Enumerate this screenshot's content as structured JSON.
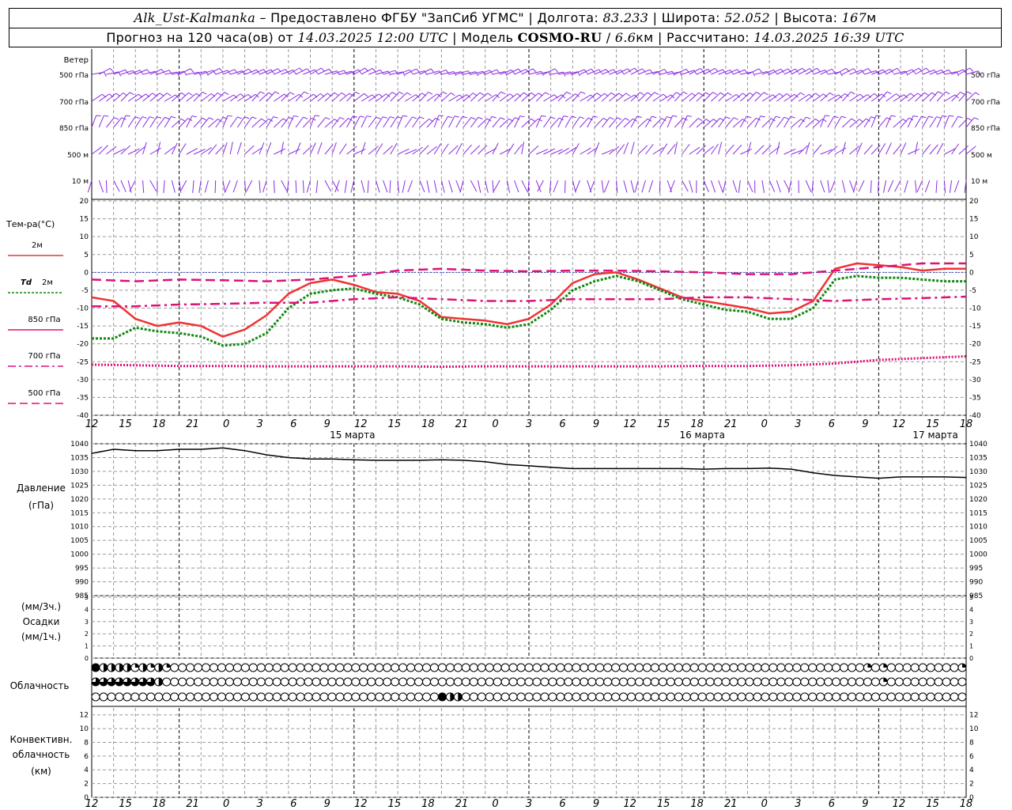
{
  "header": {
    "station": "Alk_Ust-Kalmanka",
    "provider": "Предоставлено ФГБУ \"ЗапСиб УГМС\"",
    "lon_label": "Долгота:",
    "lon_value": "83.233",
    "lat_label": "Широта:",
    "lat_value": "52.052",
    "alt_label": "Высота:",
    "alt_value": "167",
    "alt_unit": "м",
    "forecast_prefix": "Прогноз на 120 часа(ов) от",
    "forecast_start": "14.03.2025 12:00 UTC",
    "model_label": "Модель",
    "model_name": "COSMO-RU",
    "model_res": "6.6",
    "model_res_unit": "км",
    "calc_label": "Рассчитано:",
    "calc_time": "14.03.2025 16:39 UTC"
  },
  "colors": {
    "t2m": "#ee3333",
    "td2m": "#118811",
    "t850": "#dd1177",
    "t700": "#dd1177",
    "t500": "#dd1177",
    "wind": "#8a2be2",
    "pressure": "#000000",
    "grid": "#9a9a9a"
  },
  "wind_panel": {
    "title": "Ветер",
    "levels": [
      "500 гПа",
      "700 гПа",
      "850 гПа",
      "500 м",
      "10 м"
    ]
  },
  "temp_panel": {
    "title": "Тем-ра(°С)",
    "legend": [
      {
        "key": "t2m",
        "label": "2м",
        "label_prefix": "",
        "style": "solid"
      },
      {
        "key": "td2m",
        "label": "2м",
        "label_prefix": "Td",
        "style": "dotted"
      },
      {
        "key": "t850",
        "label": "850 гПа",
        "label_prefix": "",
        "style": "solid"
      },
      {
        "key": "t700",
        "label": "700 гПа",
        "label_prefix": "",
        "style": "dashdot"
      },
      {
        "key": "t500",
        "label": "500 гПа",
        "label_prefix": "",
        "style": "dashed"
      }
    ]
  },
  "pressure_panel": {
    "title_line1": "Давление",
    "title_line2": "(гПа)"
  },
  "precip_panel": {
    "title_line1": "(мм/3ч.)",
    "title_line2": "Осадки",
    "title_line3": "(мм/1ч.)"
  },
  "cloud_panel": {
    "title": "Облачность"
  },
  "conv_panel": {
    "title_line1": "Конвективн.",
    "title_line2": "облачность",
    "title_line3": "(км)"
  },
  "x_tick_labels": [
    "12",
    "15",
    "18",
    "21",
    "0",
    "3",
    "6",
    "9",
    "12",
    "15",
    "18",
    "21",
    "0",
    "3",
    "6",
    "9",
    "12",
    "15",
    "18",
    "21",
    "0",
    "3",
    "6",
    "9",
    "12",
    "15",
    "18"
  ],
  "date_labels": [
    "15 марта",
    "16 марта",
    "17 марта"
  ],
  "chart_data": [
    {
      "type": "line",
      "panel": "temperature",
      "x_unit": "hours since 14.03.2025 12:00 UTC",
      "ylim": [
        -40,
        20
      ],
      "yticks": [
        20,
        15,
        10,
        5,
        0,
        -5,
        -10,
        -15,
        -20,
        -25,
        -30,
        -35,
        -40
      ],
      "series": [
        {
          "name": "2м",
          "key": "t2m",
          "x": [
            0,
            3,
            6,
            9,
            12,
            15,
            18,
            21,
            24,
            27,
            30,
            33,
            36,
            39,
            42,
            45,
            48,
            51,
            54,
            57,
            60,
            63,
            66,
            69,
            72,
            75,
            78,
            81,
            84,
            87,
            90,
            93,
            96,
            99,
            102,
            105,
            108,
            111,
            114,
            117,
            120
          ],
          "y": [
            -7,
            -8,
            -13,
            -15,
            -14,
            -15,
            -18,
            -16,
            -12,
            -6,
            -3,
            -2,
            -3.5,
            -5.5,
            -6,
            -8,
            -12.5,
            -13,
            -13.5,
            -14.5,
            -13,
            -9,
            -3,
            -0.5,
            0,
            -2,
            -4.5,
            -7,
            -8,
            -9,
            -10,
            -11.5,
            -11,
            -8,
            1,
            2.5,
            2,
            1.5,
            0.5,
            1,
            1
          ]
        },
        {
          "name": "Td 2м",
          "key": "td2m",
          "x": [
            0,
            3,
            6,
            9,
            12,
            15,
            18,
            21,
            24,
            27,
            30,
            33,
            36,
            39,
            42,
            45,
            48,
            51,
            54,
            57,
            60,
            63,
            66,
            69,
            72,
            75,
            78,
            81,
            84,
            87,
            90,
            93,
            96,
            99,
            102,
            105,
            108,
            111,
            114,
            117,
            120
          ],
          "y": [
            -18.5,
            -18.5,
            -15.5,
            -16.5,
            -17,
            -18,
            -20.5,
            -20,
            -17,
            -10,
            -6,
            -5,
            -4.5,
            -6,
            -7,
            -9,
            -13,
            -14,
            -14.5,
            -15.5,
            -14.5,
            -10.5,
            -5,
            -2.5,
            -1,
            -2.5,
            -5,
            -7.5,
            -9,
            -10.5,
            -11,
            -13,
            -13,
            -10,
            -2,
            -1,
            -1.5,
            -1.5,
            -2,
            -2.5,
            -2.5
          ]
        },
        {
          "name": "850 гПа",
          "key": "t850",
          "x": [
            0,
            6,
            12,
            18,
            24,
            30,
            36,
            42,
            48,
            54,
            60,
            66,
            72,
            78,
            84,
            90,
            96,
            102,
            108,
            114,
            120
          ],
          "y": [
            -2,
            -2.5,
            -2,
            -2.2,
            -2.5,
            -2,
            -1,
            0.5,
            1,
            0.5,
            0.3,
            0.5,
            0.5,
            0.3,
            0,
            -0.5,
            -0.5,
            0.5,
            1.5,
            2.5,
            2.5
          ]
        },
        {
          "name": "700 гПа",
          "key": "t700",
          "x": [
            0,
            6,
            12,
            18,
            24,
            30,
            36,
            42,
            48,
            54,
            60,
            66,
            72,
            78,
            84,
            90,
            96,
            102,
            108,
            114,
            120
          ],
          "y": [
            -9.5,
            -9.5,
            -9,
            -8.8,
            -8.5,
            -8.5,
            -7.5,
            -7,
            -7.5,
            -8,
            -8,
            -7.5,
            -7.5,
            -7.5,
            -7,
            -7,
            -7.5,
            -8,
            -7.5,
            -7.2,
            -6.8
          ]
        },
        {
          "name": "500 гПа",
          "key": "t500",
          "x": [
            0,
            6,
            12,
            18,
            24,
            30,
            36,
            42,
            48,
            54,
            60,
            66,
            72,
            78,
            84,
            90,
            96,
            102,
            108,
            114,
            120
          ],
          "y": [
            -25.8,
            -26,
            -26.2,
            -26.2,
            -26.3,
            -26.3,
            -26.3,
            -26.3,
            -26.4,
            -26.3,
            -26.3,
            -26.3,
            -26.3,
            -26.3,
            -26.2,
            -26.2,
            -26,
            -25.5,
            -24.5,
            -24,
            -23.5
          ]
        }
      ]
    },
    {
      "type": "line",
      "panel": "pressure",
      "x_unit": "hours since 14.03.2025 12:00 UTC",
      "ylim": [
        985,
        1040
      ],
      "yticks": [
        1040,
        1035,
        1030,
        1025,
        1020,
        1015,
        1010,
        1005,
        1000,
        995,
        990,
        985
      ],
      "series": [
        {
          "name": "Давление",
          "key": "pressure",
          "x": [
            0,
            3,
            6,
            9,
            12,
            15,
            18,
            21,
            24,
            27,
            30,
            33,
            36,
            39,
            42,
            45,
            48,
            51,
            54,
            57,
            60,
            63,
            66,
            69,
            72,
            75,
            78,
            81,
            84,
            87,
            90,
            93,
            96,
            99,
            102,
            105,
            108,
            111,
            114,
            117,
            120
          ],
          "y": [
            1036.5,
            1038,
            1037.5,
            1037.5,
            1038,
            1038,
            1038.5,
            1037.5,
            1036,
            1035,
            1034.5,
            1034.5,
            1034.2,
            1034,
            1034,
            1034,
            1034.2,
            1034,
            1033.5,
            1032.5,
            1032,
            1031.5,
            1031,
            1031,
            1031,
            1031,
            1031,
            1031,
            1030.8,
            1031,
            1031,
            1031.2,
            1030.8,
            1029.5,
            1028.5,
            1028,
            1027.5,
            1028,
            1028,
            1028,
            1027.8
          ]
        }
      ]
    },
    {
      "type": "bar",
      "panel": "precipitation",
      "ylim": [
        0,
        5
      ],
      "yticks": [
        5,
        4,
        3,
        2,
        1,
        0
      ],
      "values": []
    },
    {
      "type": "scatter",
      "panel": "convective_cloud",
      "ylim": [
        0,
        13
      ],
      "yticks": [
        12,
        10,
        8,
        6,
        4,
        2,
        0
      ],
      "values": []
    }
  ],
  "clouds": {
    "row1": [
      4,
      2,
      2,
      2,
      2,
      1,
      2,
      1,
      2,
      1,
      0,
      0,
      0,
      0,
      0,
      0,
      0,
      0,
      0,
      0,
      0,
      0,
      0,
      0,
      0,
      0,
      0,
      0,
      0,
      0,
      0,
      0,
      0,
      0,
      0,
      0,
      0,
      0,
      0,
      0,
      0,
      0,
      0,
      0,
      0,
      0,
      0,
      0,
      0,
      0,
      0,
      0,
      0,
      0,
      0,
      0,
      0,
      0,
      0,
      0,
      0,
      0,
      0,
      0,
      0,
      0,
      0,
      0,
      0,
      0,
      0,
      0,
      0,
      0,
      0,
      0,
      0,
      0,
      0,
      0,
      0,
      0,
      0,
      0,
      0,
      0,
      0,
      0,
      0,
      0,
      0,
      0,
      0,
      0,
      0,
      0,
      0,
      0,
      1,
      0,
      1,
      0,
      0,
      0,
      0,
      0,
      0,
      0,
      0,
      0,
      1
    ],
    "row2": [
      3,
      3,
      3,
      3,
      3,
      3,
      3,
      3,
      2,
      0,
      0,
      0,
      0,
      0,
      0,
      0,
      0,
      0,
      0,
      0,
      0,
      0,
      0,
      0,
      0,
      0,
      0,
      0,
      0,
      0,
      0,
      0,
      0,
      0,
      0,
      0,
      0,
      0,
      0,
      0,
      0,
      0,
      0,
      0,
      0,
      0,
      0,
      0,
      0,
      0,
      0,
      0,
      0,
      0,
      0,
      0,
      0,
      0,
      0,
      0,
      0,
      0,
      0,
      0,
      0,
      0,
      0,
      0,
      0,
      0,
      0,
      0,
      0,
      0,
      0,
      0,
      0,
      0,
      0,
      0,
      0,
      0,
      0,
      0,
      0,
      0,
      0,
      0,
      0,
      0,
      0,
      0,
      0,
      0,
      0,
      0,
      0,
      0,
      0,
      0,
      1,
      0,
      0,
      0,
      0,
      0,
      0,
      0,
      0,
      0,
      0
    ],
    "row3": [
      0,
      0,
      0,
      0,
      0,
      0,
      0,
      0,
      0,
      0,
      0,
      0,
      0,
      0,
      0,
      0,
      0,
      0,
      0,
      0,
      0,
      0,
      0,
      0,
      0,
      0,
      0,
      0,
      0,
      0,
      0,
      0,
      0,
      0,
      0,
      0,
      0,
      0,
      0,
      0,
      0,
      0,
      0,
      0,
      4,
      2,
      2,
      0,
      0,
      0,
      0,
      0,
      0,
      0,
      0,
      0,
      0,
      0,
      0,
      0,
      0,
      0,
      0,
      0,
      0,
      0,
      0,
      0,
      0,
      0,
      0,
      0,
      0,
      0,
      0,
      0,
      0,
      0,
      0,
      0,
      0,
      0,
      0,
      0,
      0,
      0,
      0,
      0,
      0,
      0,
      0,
      0,
      0,
      0,
      0,
      0,
      0,
      0,
      0,
      0,
      0,
      0,
      0,
      0,
      0,
      0,
      0,
      0,
      0,
      0,
      0
    ]
  }
}
